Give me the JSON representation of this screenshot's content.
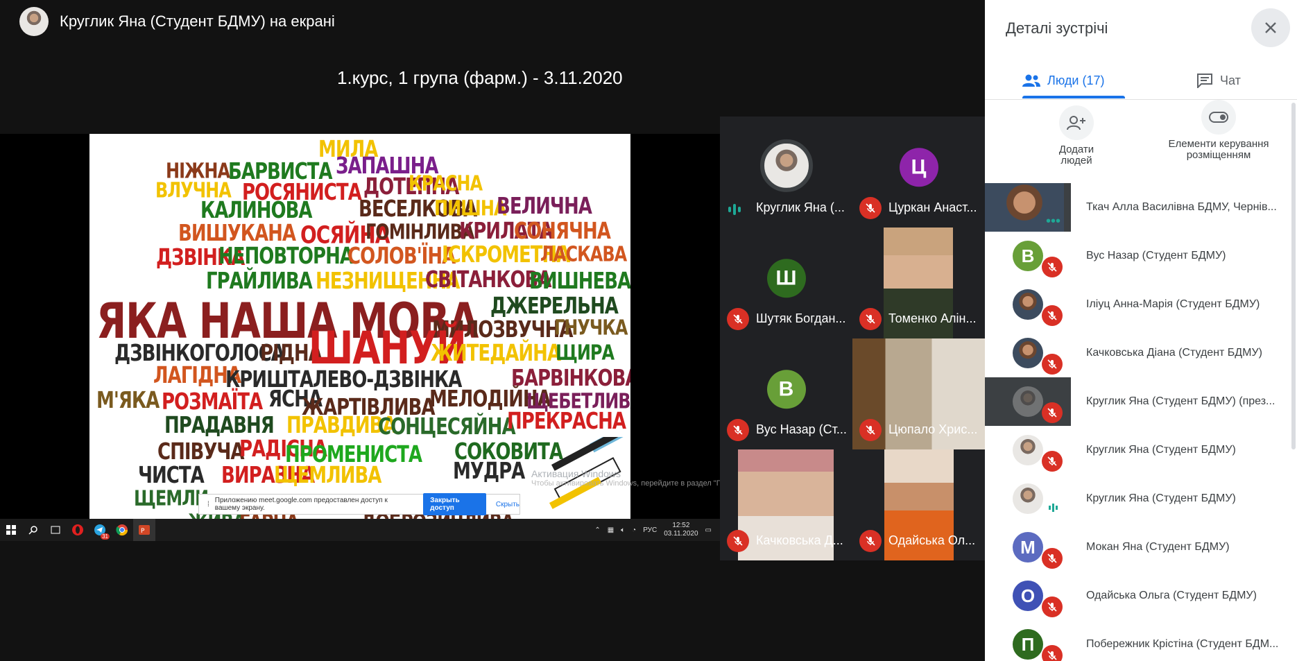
{
  "header": {
    "presenter_text": "Круглик Яна (Студент БДМУ) на екрані",
    "meeting_title": "1.курс, 1 група (фарм.) - 3.11.2020"
  },
  "slide": {
    "words": [
      {
        "t": "МИЛА",
        "c": "#f2c200"
      },
      {
        "t": "НІЖНА",
        "c": "#8b3a1a"
      },
      {
        "t": "БАРВИСТА",
        "c": "#1f7a1f"
      },
      {
        "t": "ЗАПАШНА",
        "c": "#7a1f8b"
      },
      {
        "t": "ВЛУЧНА",
        "c": "#f2c200"
      },
      {
        "t": "РОСЯНИСТА",
        "c": "#d21f1f"
      },
      {
        "t": "ДОТЕПНА",
        "c": "#8b1f3a"
      },
      {
        "t": "КРАСНА",
        "c": "#f2c200"
      },
      {
        "t": "КАЛИНОВА",
        "c": "#1f7a1f"
      },
      {
        "t": "ВЕСЕЛКОВА",
        "c": "#5a2a1a"
      },
      {
        "t": "ПИШНА",
        "c": "#f2c200"
      },
      {
        "t": "ВЕЛИЧНА",
        "c": "#7a1f5a"
      },
      {
        "t": "ВИШУКАНА",
        "c": "#d2561f"
      },
      {
        "t": "ОСЯЙНА",
        "c": "#d21f1f"
      },
      {
        "t": "ГОМІНЛИВА",
        "c": "#5a2a1a"
      },
      {
        "t": "КРИЛАТА",
        "c": "#8b1f3a"
      },
      {
        "t": "СОНЯЧНА",
        "c": "#d2561f"
      },
      {
        "t": "ДЗВІНКА",
        "c": "#d21f1f"
      },
      {
        "t": "НЕПОВТОРНА",
        "c": "#1f7a1f"
      },
      {
        "t": "СОЛОВ'ЇНА",
        "c": "#d2561f"
      },
      {
        "t": "ІСКРОМЕТНА",
        "c": "#f2c200"
      },
      {
        "t": "ЛАСКАВА",
        "c": "#d2561f"
      },
      {
        "t": "ГРАЙЛИВА",
        "c": "#1f7a1f"
      },
      {
        "t": "НЕЗНИЩЕННА",
        "c": "#f2c200"
      },
      {
        "t": "СВІТАНКОВА",
        "c": "#8b1f3a"
      },
      {
        "t": "ВИШНЕВА",
        "c": "#1f7a1f"
      },
      {
        "t": "ЯКА НАША МОВА",
        "c": "#8b1f1f"
      },
      {
        "t": "ДЖЕРЕЛЬНА",
        "c": "#1f4a1f"
      },
      {
        "t": "МИЛОЗВУЧНА",
        "c": "#5a2a1a"
      },
      {
        "t": "ГНУЧКА",
        "c": "#7a5a1f"
      },
      {
        "t": "ДЗВІНКОГОЛОСА",
        "c": "#2a2a2a"
      },
      {
        "t": "РІДНА",
        "c": "#5a2a1a"
      },
      {
        "t": "ШАНУЙ",
        "c": "#d21f1f"
      },
      {
        "t": "ЖИТЕДАЙНА",
        "c": "#f2c200"
      },
      {
        "t": "ЩИРА",
        "c": "#1f7a1f"
      },
      {
        "t": "ЛАГІДНА",
        "c": "#d2561f"
      },
      {
        "t": "КРИШТАЛЕВО-ДЗВІНКА",
        "c": "#2a2a2a"
      },
      {
        "t": "БАРВІНКОВА",
        "c": "#8b1f3a"
      },
      {
        "t": "М'ЯКА",
        "c": "#7a5a1f"
      },
      {
        "t": "РОЗМАЇТА",
        "c": "#d21f1f"
      },
      {
        "t": "ЯСНА",
        "c": "#2a2a2a"
      },
      {
        "t": "ЖАРТІВЛИВА",
        "c": "#5a2a1a"
      },
      {
        "t": "МЕЛОДІЙНА",
        "c": "#5a2a1a"
      },
      {
        "t": "ЩЕБЕТЛИВА",
        "c": "#7a1f5a"
      },
      {
        "t": "ПРАДАВНЯ",
        "c": "#1f4a1f"
      },
      {
        "t": "ПРАВДИВА",
        "c": "#f2c200"
      },
      {
        "t": "СОНЦЕСЯЙНА",
        "c": "#2a6a2a"
      },
      {
        "t": "ПРЕКРАСНА",
        "c": "#d21f1f"
      },
      {
        "t": "СПІВУЧА",
        "c": "#5a2a1a"
      },
      {
        "t": "РАДІСНА",
        "c": "#d21f1f"
      },
      {
        "t": "ПРОМЕНИСТА",
        "c": "#1ea81e"
      },
      {
        "t": "СОКОВИТА",
        "c": "#1f6a1f"
      },
      {
        "t": "ЧИСТА",
        "c": "#2a2a2a"
      },
      {
        "t": "ВИРАЗНА",
        "c": "#d21f1f"
      },
      {
        "t": "ЩЕМЛИВА",
        "c": "#f2c200"
      },
      {
        "t": "МУДРА",
        "c": "#2a2a2a"
      },
      {
        "t": "ЩЕМЛИ",
        "c": "#2a6a2a"
      },
      {
        "t": "ЖИВА",
        "c": "#2a6a2a"
      },
      {
        "t": "ГАРНА",
        "c": "#8b3a1a"
      },
      {
        "t": "ДОБРОЗИЧЛИВА",
        "c": "#5a2a1a"
      }
    ],
    "watermark_title": "Активация Windows",
    "watermark_sub": "Чтобы активировать Windows, перейдите в раздел \"Параметры\".",
    "share_text": "Приложению meet.google.com предоставлен доступ к вашему экрану.",
    "share_button": "Закрыть доступ",
    "share_hide": "Скрыть"
  },
  "taskbar": {
    "lang": "РУС",
    "time": "12:52",
    "date": "03.11.2020",
    "badge": "31"
  },
  "tiles": [
    {
      "name": "Круглик Яна (...",
      "initial": "",
      "color": "",
      "speaking": true
    },
    {
      "name": "Цуркан Анаст...",
      "initial": "Ц",
      "color": "#8e24aa",
      "speaking": false
    },
    {
      "name": "Шутяк Богдан...",
      "initial": "Ш",
      "color": "#2e6b1f",
      "speaking": false
    },
    {
      "name": "Томенко Алін...",
      "initial": "",
      "color": "",
      "speaking": false
    },
    {
      "name": "Вус Назар (Ст...",
      "initial": "В",
      "color": "#689f38",
      "speaking": false
    },
    {
      "name": "Цюпало Хрис...",
      "initial": "",
      "color": "",
      "speaking": false
    },
    {
      "name": "Качковська Д...",
      "initial": "",
      "color": "",
      "speaking": false
    },
    {
      "name": "Одайська Ол...",
      "initial": "",
      "color": "",
      "speaking": false
    }
  ],
  "panel": {
    "title": "Деталі зустрічі",
    "tab_people": "Люди (17)",
    "tab_chat": "Чат",
    "add_people": "Додати людей",
    "layout_controls": "Елементи керування розміщенням",
    "people": [
      {
        "name": "Ткач Алла Василівна БДМУ, Чернів...",
        "initial": "",
        "color": "",
        "video": true
      },
      {
        "name": "Вус Назар (Студент БДМУ)",
        "initial": "В",
        "color": "#689f38",
        "video": false
      },
      {
        "name": "Іліуц Анна-Марія (Студент БДМУ)",
        "initial": "",
        "color": "",
        "video": false
      },
      {
        "name": "Качковська Діана (Студент БДМУ)",
        "initial": "",
        "color": "",
        "video": false
      },
      {
        "name": "Круглик Яна (Студент БДМУ) (през...",
        "initial": "",
        "color": "",
        "video": true
      },
      {
        "name": "Круглик Яна (Студент БДМУ)",
        "initial": "",
        "color": "",
        "video": false
      },
      {
        "name": "Круглик Яна (Студент БДМУ)",
        "initial": "",
        "color": "",
        "video": false
      },
      {
        "name": "Мокан Яна (Студент БДМУ)",
        "initial": "М",
        "color": "#5c6bc0",
        "video": false
      },
      {
        "name": "Одайська Ольга (Студент БДМУ)",
        "initial": "О",
        "color": "#3f51b5",
        "video": false
      },
      {
        "name": "Побережник Крістіна (Студент БДМ...",
        "initial": "П",
        "color": "#2e6b1f",
        "video": false
      }
    ]
  }
}
